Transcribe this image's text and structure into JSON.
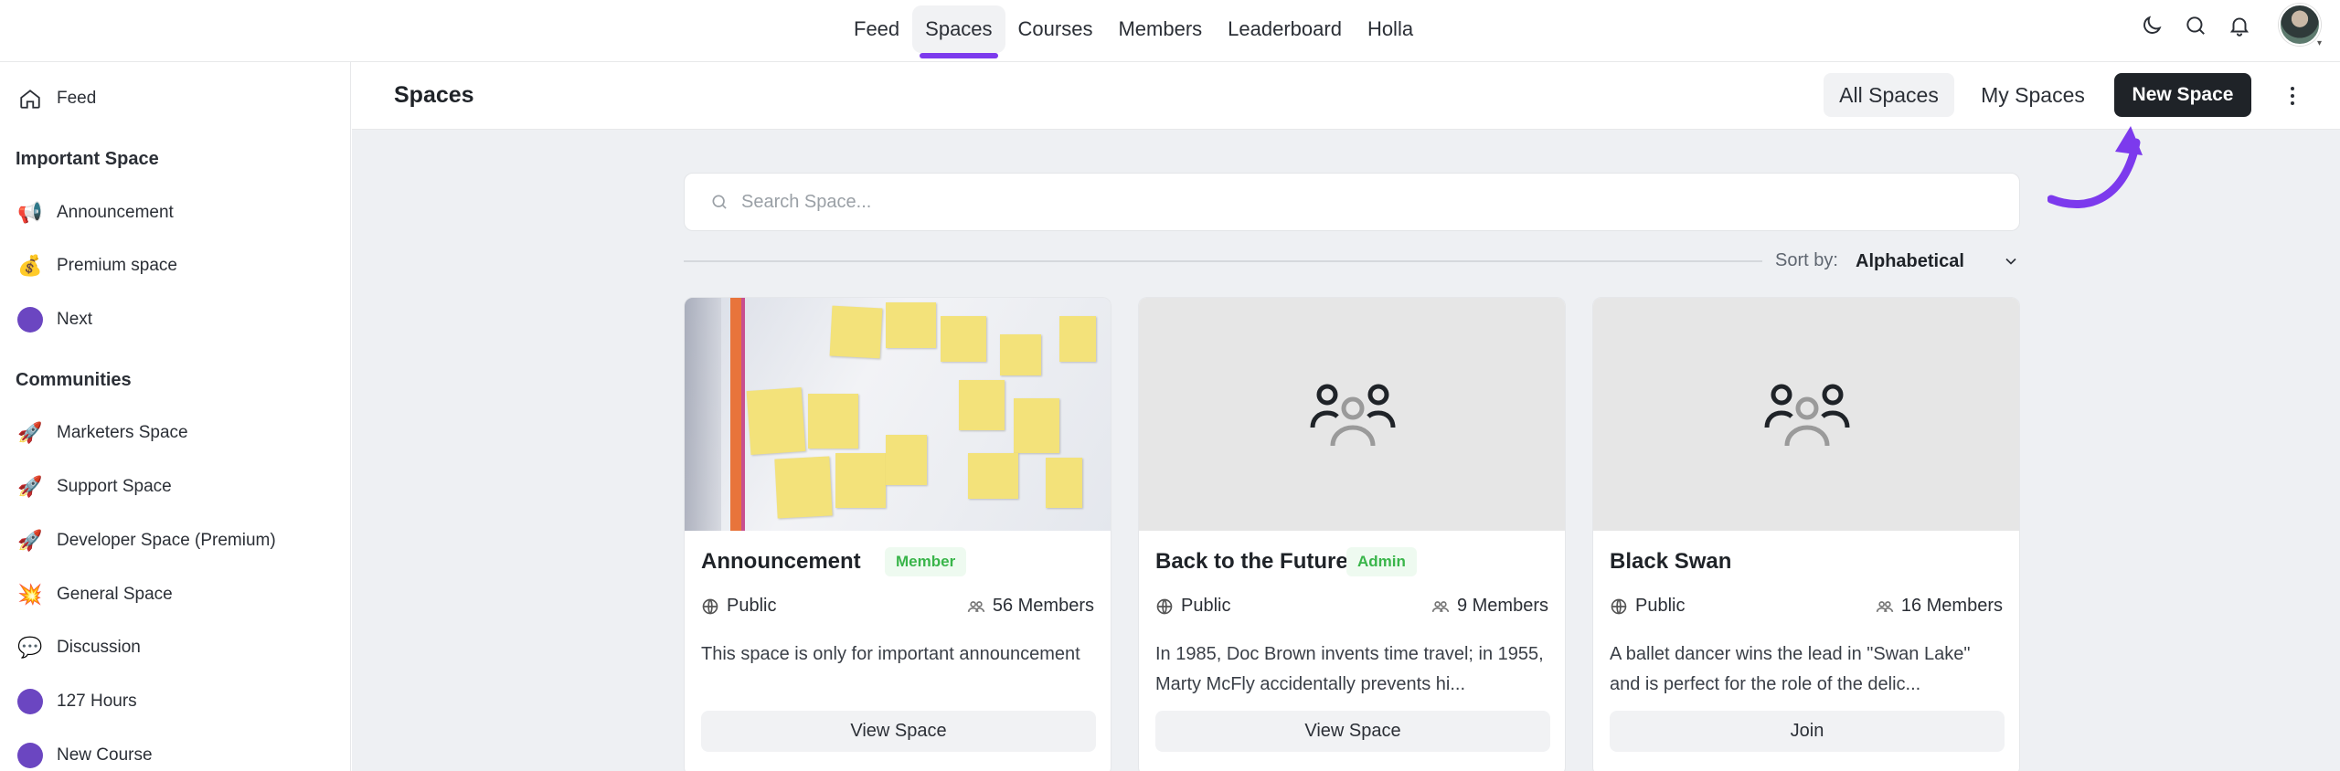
{
  "topnav": {
    "items": [
      "Feed",
      "Spaces",
      "Courses",
      "Members",
      "Leaderboard",
      "Holla"
    ],
    "active_index": 1
  },
  "sidebar": {
    "feed_label": "Feed",
    "section1_title": "Important Space",
    "section1_items": [
      {
        "label": "Announcement",
        "icon": "📢"
      },
      {
        "label": "Premium space",
        "icon": "💰"
      },
      {
        "label": "Next",
        "icon": "purple-dot"
      }
    ],
    "section2_title": "Communities",
    "section2_items": [
      {
        "label": "Marketers Space",
        "icon": "🚀"
      },
      {
        "label": "Support Space",
        "icon": "🚀"
      },
      {
        "label": "Developer Space (Premium)",
        "icon": "🚀"
      },
      {
        "label": "General Space",
        "icon": "💥"
      },
      {
        "label": "Discussion",
        "icon": "💬"
      },
      {
        "label": "127 Hours",
        "icon": "purple-dot"
      },
      {
        "label": "New Course",
        "icon": "purple-dot"
      }
    ]
  },
  "header": {
    "title": "Spaces",
    "all_spaces": "All Spaces",
    "my_spaces": "My Spaces",
    "new_space": "New Space"
  },
  "search": {
    "placeholder": "Search Space..."
  },
  "sort": {
    "label": "Sort by:",
    "value": "Alphabetical"
  },
  "cards": [
    {
      "title": "Announcement",
      "badge": "Member",
      "privacy": "Public",
      "members": "56 Members",
      "description": "This space is only for important announcement",
      "button": "View Space"
    },
    {
      "title": "Back to the Future",
      "badge": "Admin",
      "privacy": "Public",
      "members": "9 Members",
      "description": "In 1985, Doc Brown invents time travel; in 1955, Marty McFly accidentally prevents hi...",
      "button": "View Space"
    },
    {
      "title": "Black Swan",
      "badge": "",
      "privacy": "Public",
      "members": "16 Members",
      "description": "A ballet dancer wins the lead in \"Swan Lake\" and is perfect for the role of the delic...",
      "button": "Join"
    }
  ],
  "colors": {
    "accent": "#7c3aed",
    "badge_green": "#39b54a",
    "dark_button": "#1f2328",
    "main_bg": "#eef0f3"
  }
}
